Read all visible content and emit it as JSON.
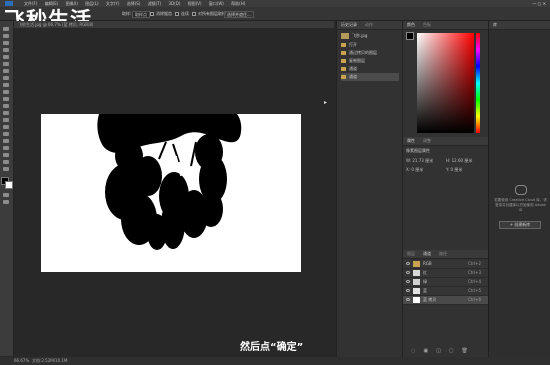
{
  "watermark": "飞秒生活",
  "menu": [
    "文件(F)",
    "编辑(E)",
    "图像(I)",
    "图层(L)",
    "文字(Y)",
    "选择(S)",
    "滤镜(T)",
    "3D(D)",
    "视图(V)",
    "窗口(W)",
    "帮助(H)"
  ],
  "options_bar": {
    "sample_label": "取样:",
    "sample_value": "取样点",
    "radius_label": "宽度:",
    "check1": "消除锯齿",
    "check2": "连续",
    "check3": "对所有图层取样",
    "btn": "选择并遮住..."
  },
  "doc_tab": "飞秒生活.jpg @ 66.7% (蓝 拷贝, RGB/8)",
  "canvas_caption": "然后点“确定”",
  "status": {
    "zoom": "66.67%",
    "doc": "文档:2.52M/10.1M"
  },
  "history": {
    "tab_history": "历史记录",
    "tab_actions": "动作",
    "snapshot": "飞秒.jpg",
    "items": [
      "打开",
      "通过拷贝的图层",
      "复制图层",
      "通道",
      "通道"
    ]
  },
  "color_panel": {
    "tab_color": "颜色",
    "tab_swatches": "色板",
    "fg": "#000000",
    "bg": "#ffffff"
  },
  "properties": {
    "tab_props": "属性",
    "tab_adjust": "调整",
    "title": "像素图层属性",
    "w_label": "W:",
    "w_value": "21.73 厘米",
    "h_label": "H:",
    "h_value": "12.60 厘米",
    "x_label": "X:",
    "x_value": "0 厘米",
    "y_label": "Y:",
    "y_value": "0 厘米"
  },
  "layers_panel": {
    "tab_layers": "图层",
    "tab_channels": "通道",
    "tab_paths": "路径",
    "rows": [
      {
        "name": "RGB",
        "shortcut": "Ctrl+2",
        "thumb": "#c9a352"
      },
      {
        "name": "红",
        "shortcut": "Ctrl+3",
        "thumb": "#d8d8d8"
      },
      {
        "name": "绿",
        "shortcut": "Ctrl+4",
        "thumb": "#d0d0d0"
      },
      {
        "name": "蓝",
        "shortcut": "Ctrl+5",
        "thumb": "#e2e2e2"
      },
      {
        "name": "蓝 拷贝",
        "shortcut": "Ctrl+6",
        "thumb": "#ffffff"
      }
    ]
  },
  "libraries": {
    "title": "库",
    "message": "若要使用 Creative Cloud 库，请登录并创建库以开始使用 Adobe ID",
    "button": "+ 创建新库"
  }
}
